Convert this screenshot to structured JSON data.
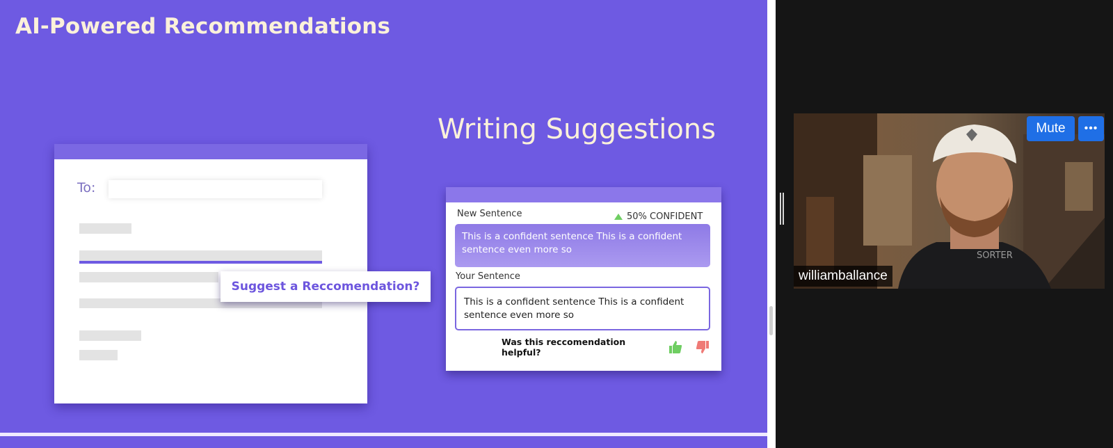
{
  "slide": {
    "title": "AI-Powered Recommendations",
    "section_title": "Writing Suggestions",
    "email_mock": {
      "to_label": "To:",
      "suggest_button_label": "Suggest a Reccomendation?"
    },
    "suggestion_card": {
      "new_sentence_label": "New Sentence",
      "confidence": "50% CONFIDENT",
      "new_sentence_text": "This is a confident sentence This is a confident sentence even more so",
      "your_sentence_label": "Your Sentence",
      "your_sentence_text": "This is a confident sentence This is a confident sentence even more so",
      "helpful_question": "Was this reccomendation helpful?",
      "thumbs_up_color": "#6fce62",
      "thumbs_down_color": "#ef7a76"
    },
    "background_color": "#6e5ae2",
    "title_color": "#fbf1da"
  },
  "video": {
    "participant_name": "williamballance",
    "mute_label": "Mute",
    "more_label": "•••",
    "shirt_logo": "SORTER",
    "button_color": "#1f6fe6"
  }
}
